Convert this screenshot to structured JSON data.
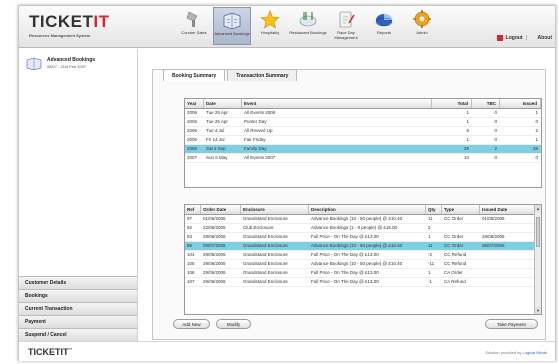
{
  "header": {
    "logo_prefix": "TICKET",
    "logo_accent": "IT",
    "logo_subtitle": "Resources Management System",
    "logout_label": "Logout",
    "about_label": "About"
  },
  "nav": [
    {
      "label": "Counter Sales",
      "icon": "barcode-scanner-icon"
    },
    {
      "label": "Advanced Bookings",
      "icon": "calendar-book-icon",
      "active": true
    },
    {
      "label": "Hospitality",
      "icon": "star-icon"
    },
    {
      "label": "Restaurant Bookings",
      "icon": "cutlery-icon"
    },
    {
      "label": "Race Day Management",
      "icon": "clipboard-pen-icon"
    },
    {
      "label": "Reports",
      "icon": "pie-chart-icon"
    },
    {
      "label": "Admin",
      "icon": "gear-icon"
    }
  ],
  "booking": {
    "title": "Advanced Bookings",
    "dates": "08/07 - 21st Feb 2007"
  },
  "tabs": [
    "Booking Summary",
    "Transaction Summary"
  ],
  "events_table": {
    "headers": [
      "Year",
      "Date",
      "Event",
      "Total",
      "TBC",
      "Issued"
    ],
    "rows": [
      [
        "2006",
        "Tue 25 Apr",
        "All Events 2006",
        "1",
        "0",
        "1"
      ],
      [
        "2006",
        "Tue 25 Apr",
        "Punter Day",
        "1",
        "0",
        "0"
      ],
      [
        "2006",
        "Tue 4 Jul",
        "All Revved Up",
        "6",
        "0",
        "2"
      ],
      [
        "2006",
        "Fri 14 Jul",
        "Fair Friday",
        "1",
        "0",
        "1"
      ],
      [
        "2006",
        "Sat 2 Sep",
        "Family Day",
        "26",
        "2",
        "26"
      ],
      [
        "2007",
        "Sun 6 May",
        "All Events 2007",
        "10",
        "0",
        "0"
      ]
    ],
    "selected_index": 4
  },
  "transactions_table": {
    "headers": [
      "Ref",
      "Order Date",
      "Enclosure",
      "Description",
      "Qty",
      "Type",
      "Issued Date"
    ],
    "rows": [
      [
        "97",
        "01/06/2006",
        "Grandstand Enclosure",
        "Advance Bookings (10 - 50 people) @ £10.40",
        "11",
        "CC Order",
        "01/06/2006"
      ],
      [
        "92",
        "22/06/2006",
        "Club Enclosure",
        "Advance Bookings (1 - 9 people) @ £16.00",
        "2",
        "",
        ""
      ],
      [
        "93",
        "28/06/2006",
        "Grandstand Enclosure",
        "Full Price - On The Day @ £13.00",
        "1",
        "CC Order",
        "28/06/2006"
      ],
      [
        "96",
        "05/07/2006",
        "Grandstand Enclosure",
        "Advance Bookings (10 - 50 people) @ £10.40",
        "11",
        "CC Order",
        "05/07/2006"
      ],
      [
        "104",
        "29/06/2006",
        "Grandstand Enclosure",
        "Full Price - On The Day @ £13.00",
        "-2",
        "CC Refund",
        ""
      ],
      [
        "105",
        "29/06/2006",
        "Grandstand Enclosure",
        "Advance Bookings (10 - 50 people) @ £10.40",
        "-11",
        "CC Refund",
        ""
      ],
      [
        "106",
        "29/06/2006",
        "Grandstand Enclosure",
        "Full Price - On The Day @ £13.00",
        "1",
        "CA Order",
        ""
      ],
      [
        "107",
        "29/06/2006",
        "Grandstand Enclosure",
        "Full Price - On The Day @ £13.00",
        "-1",
        "CA Refund",
        ""
      ]
    ],
    "selected_index": 3
  },
  "buttons": {
    "add_new": "Add New",
    "modify": "Modify",
    "take_payment": "Take Payment"
  },
  "side_menu": [
    "Customer Details",
    "Bookings",
    "Current Transaction",
    "Payment",
    "Suspend / Cancel"
  ],
  "footer": {
    "logo": "TICKETIT",
    "tm": "™",
    "credit_prefix": "Solution provided by ",
    "credit_company": "Logical Minds"
  },
  "colors": {
    "brand_red": "#d7262e",
    "selection": "#7fcfe3",
    "nav_active": "#aab6cc"
  }
}
